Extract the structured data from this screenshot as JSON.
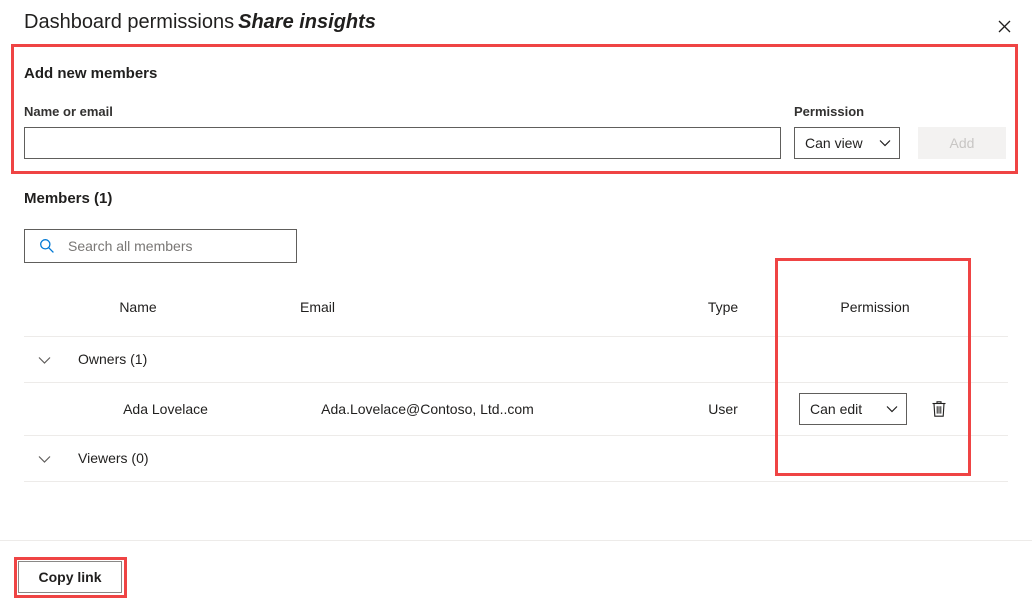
{
  "header": {
    "title_main": "Dashboard permissions",
    "title_italic": "Share insights",
    "close_icon": "close-icon"
  },
  "add_members": {
    "heading": "Add new members",
    "name_label": "Name or email",
    "name_value": "",
    "name_placeholder": "",
    "permission_label": "Permission",
    "permission_value": "Can view",
    "permission_options": [
      "Can view",
      "Can edit"
    ],
    "add_button_label": "Add",
    "add_button_disabled": true,
    "chevron_icon": "chevron-down-icon"
  },
  "members": {
    "heading": "Members (1)",
    "search_placeholder": "Search all members",
    "search_value": "",
    "search_icon": "search-icon",
    "columns": [
      "Name",
      "Email",
      "Type",
      "Permission"
    ],
    "groups": [
      {
        "label": "Owners (1)",
        "expanded": true,
        "chevron_icon": "chevron-down-icon",
        "rows": [
          {
            "name": "Ada Lovelace",
            "email": "Ada.Lovelace@Contoso, Ltd..com",
            "type": "User",
            "permission": "Can edit",
            "permission_options": [
              "Can view",
              "Can edit"
            ],
            "delete_icon": "trash-icon"
          }
        ]
      },
      {
        "label": "Viewers (0)",
        "expanded": true,
        "chevron_icon": "chevron-down-icon",
        "rows": []
      }
    ]
  },
  "footer": {
    "copy_link_label": "Copy link"
  },
  "annotations": {
    "color": "#ef4444",
    "boxes": [
      "add-new-members-section",
      "permission-column",
      "copy-link-button"
    ]
  }
}
